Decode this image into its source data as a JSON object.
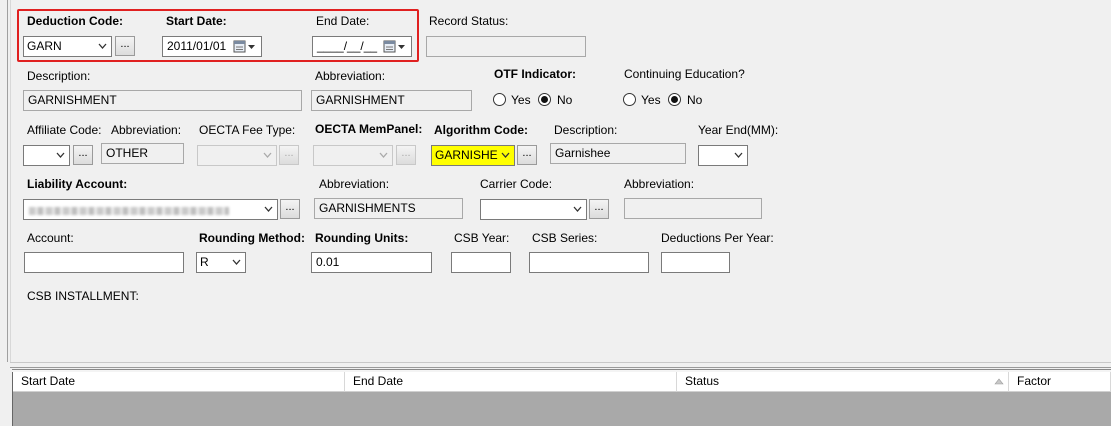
{
  "form": {
    "deduction_code_label": "Deduction Code:",
    "deduction_code_value": "GARN",
    "start_date_label": "Start Date:",
    "start_date_value": "2011/01/01",
    "end_date_label": "End Date:",
    "end_date_value": "____/__/__",
    "record_status_label": "Record Status:",
    "record_status_value": "",
    "description_label": "Description:",
    "description_value": "GARNISHMENT",
    "abbreviation_label": "Abbreviation:",
    "abbreviation_value": "GARNISHMENT",
    "otf_label": "OTF Indicator:",
    "otf_yes": "Yes",
    "otf_no": "No",
    "otf_selected": "No",
    "cont_ed_label": "Continuing Education?",
    "cont_ed_yes": "Yes",
    "cont_ed_no": "No",
    "cont_ed_selected": "No",
    "affiliate_code_label": "Affiliate Code:",
    "affiliate_code_value": "",
    "affiliate_abbrev_label": "Abbreviation:",
    "affiliate_abbrev_value": "OTHER",
    "oecta_fee_label": "OECTA Fee Type:",
    "oecta_fee_value": "",
    "oecta_mem_label": "OECTA MemPanel:",
    "oecta_mem_value": "",
    "algorithm_code_label": "Algorithm Code:",
    "algorithm_code_value": "GARNISHE",
    "algo_desc_label": "Description:",
    "algo_desc_value": "Garnishee",
    "year_end_label": "Year End(MM):",
    "year_end_value": "",
    "liability_account_label": "Liability Account:",
    "liability_abbrev_label": "Abbreviation:",
    "liability_abbrev_value": "GARNISHMENTS",
    "carrier_code_label": "Carrier Code:",
    "carrier_code_value": "",
    "carrier_abbrev_label": "Abbreviation:",
    "carrier_abbrev_value": "",
    "account_label": "Account:",
    "account_value": "",
    "rounding_method_label": "Rounding Method:",
    "rounding_method_value": "R",
    "rounding_units_label": "Rounding Units:",
    "rounding_units_value": "0.01",
    "csb_year_label": "CSB Year:",
    "csb_year_value": "",
    "csb_series_label": "CSB Series:",
    "csb_series_value": "",
    "deductions_per_year_label": "Deductions Per Year:",
    "deductions_per_year_value": "",
    "csb_installment_label": "CSB INSTALLMENT:",
    "ellipsis": "..."
  },
  "grid": {
    "columns": [
      "Start Date",
      "End Date",
      "Status",
      "Factor"
    ]
  },
  "colors": {
    "highlight_box": "#e02020",
    "highlight_field": "#ffff00",
    "grid_body": "#a9a9a9"
  }
}
